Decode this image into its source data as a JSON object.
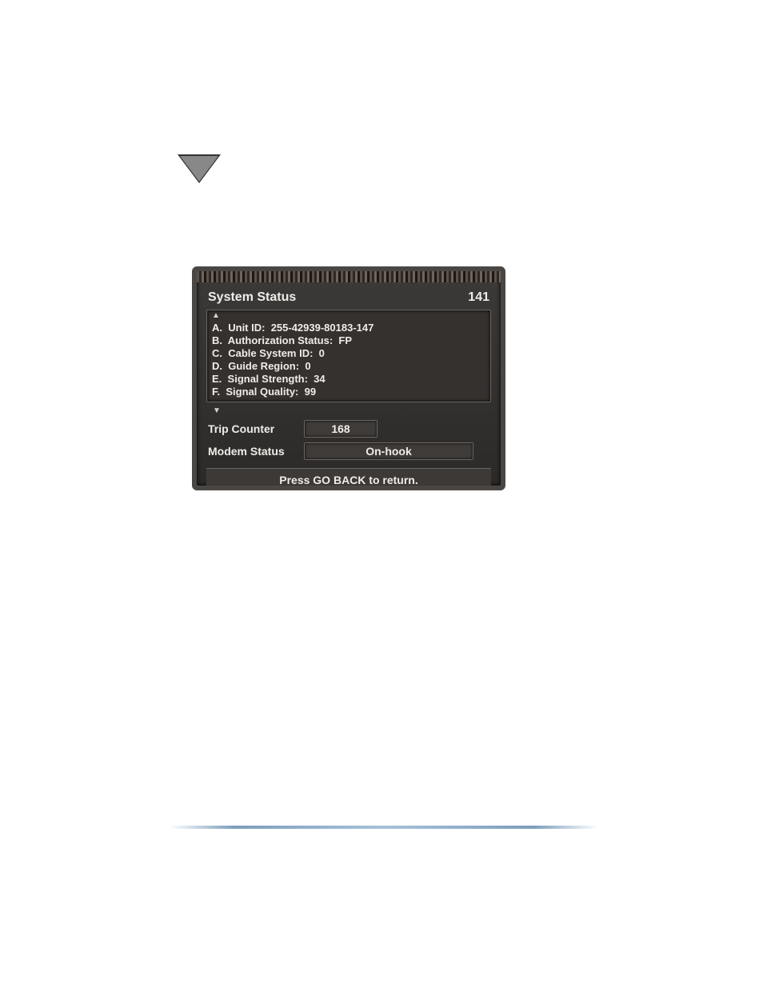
{
  "panel": {
    "title": "System Status",
    "number": "141",
    "items": [
      {
        "letter": "A.",
        "label": "Unit ID:",
        "value": "255-42939-80183-147"
      },
      {
        "letter": "B.",
        "label": "Authorization Status:",
        "value": "FP"
      },
      {
        "letter": "C.",
        "label": "Cable System ID:",
        "value": "0"
      },
      {
        "letter": "D.",
        "label": "Guide Region:",
        "value": "0"
      },
      {
        "letter": "E.",
        "label": "Signal Strength:",
        "value": "34"
      },
      {
        "letter": "F.",
        "label": "Signal Quality:",
        "value": "99"
      }
    ],
    "trip_label": "Trip Counter",
    "trip_value": "168",
    "modem_label": "Modem Status",
    "modem_value": "On-hook",
    "hint": "Press GO BACK to return."
  }
}
